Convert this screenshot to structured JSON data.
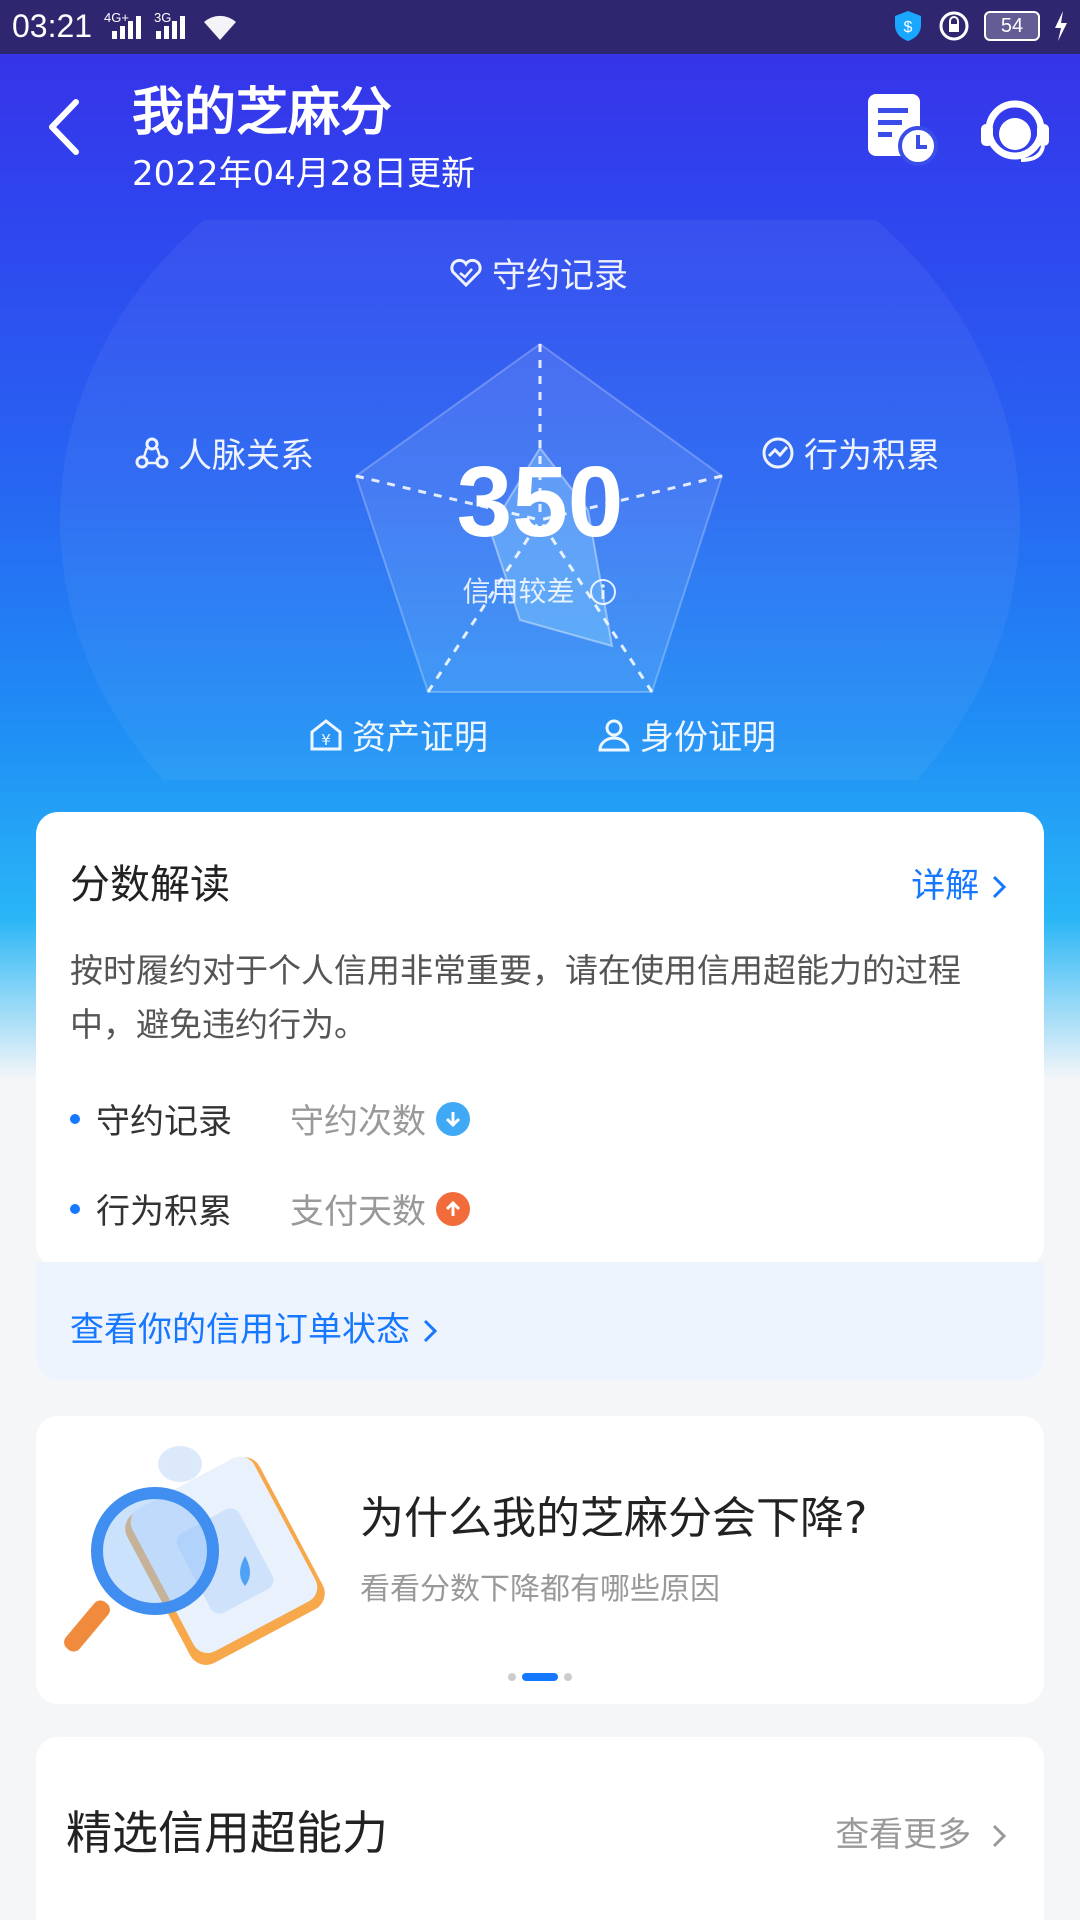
{
  "status_bar": {
    "time": "03:21",
    "network1": "4G+",
    "network2": "3G",
    "battery": "54"
  },
  "header": {
    "title": "我的芝麻分",
    "updated": "2022年04月28日更新"
  },
  "score": {
    "value": "350",
    "level": "信用较差",
    "dimensions": {
      "top": "守约记录",
      "left": "人脉关系",
      "right": "行为积累",
      "bottom_left": "资产证明",
      "bottom_right": "身份证明"
    }
  },
  "interpretation": {
    "title": "分数解读",
    "detail_link": "详解",
    "description": "按时履约对于个人信用非常重要，请在使用信用超能力的过程中，避免违约行为。",
    "items": [
      {
        "label": "守约记录",
        "value": "守约次数",
        "trend": "down"
      },
      {
        "label": "行为积累",
        "value": "支付天数",
        "trend": "up"
      }
    ],
    "footer_link": "查看你的信用订单状态"
  },
  "banner": {
    "title": "为什么我的芝麻分会下降?",
    "subtitle": "看看分数下降都有哪些原因"
  },
  "featured": {
    "title": "精选信用超能力",
    "more_link": "查看更多"
  },
  "colors": {
    "accent": "#1677ff",
    "trend_down": "#3fa9f5",
    "trend_up": "#f26b3a"
  }
}
